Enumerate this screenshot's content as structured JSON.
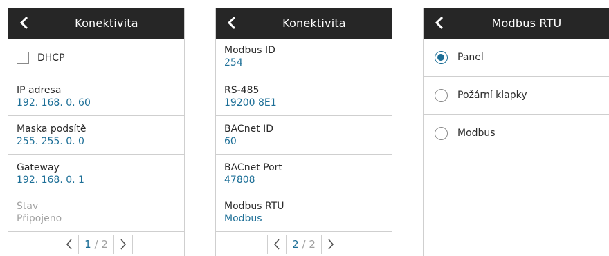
{
  "screens": [
    {
      "title": "Konektivita",
      "checkbox": {
        "label": "DHCP",
        "checked": false
      },
      "fields": [
        {
          "label": "IP adresa",
          "value": "192. 168. 0. 60"
        },
        {
          "label": "Maska podsítě",
          "value": "255. 255. 0. 0"
        },
        {
          "label": "Gateway",
          "value": "192. 168. 0. 1"
        },
        {
          "label": "Stav",
          "value": "Připojeno",
          "disabled": true
        }
      ],
      "pager": {
        "current": "1",
        "sep": "/",
        "total": "2"
      }
    },
    {
      "title": "Konektivita",
      "fields": [
        {
          "label": "Modbus ID",
          "value": "254"
        },
        {
          "label": "RS-485",
          "value": "19200 8E1"
        },
        {
          "label": "BACnet ID",
          "value": "60"
        },
        {
          "label": "BACnet Port",
          "value": "47808"
        },
        {
          "label": "Modbus RTU",
          "value": "Modbus"
        }
      ],
      "pager": {
        "current": "2",
        "sep": "/",
        "total": "2"
      }
    },
    {
      "title": "Modbus RTU",
      "options": [
        {
          "label": "Panel",
          "selected": true
        },
        {
          "label": "Požární klapky",
          "selected": false
        },
        {
          "label": "Modbus",
          "selected": false
        }
      ]
    }
  ],
  "icons": {
    "back": "chevron-left-icon",
    "prev": "chevron-left-icon",
    "next": "chevron-right-icon"
  },
  "colors": {
    "header_bg": "#262626",
    "accent": "#1d6f97",
    "divider": "#cfcfcf",
    "disabled_text": "#a2a2a2"
  }
}
